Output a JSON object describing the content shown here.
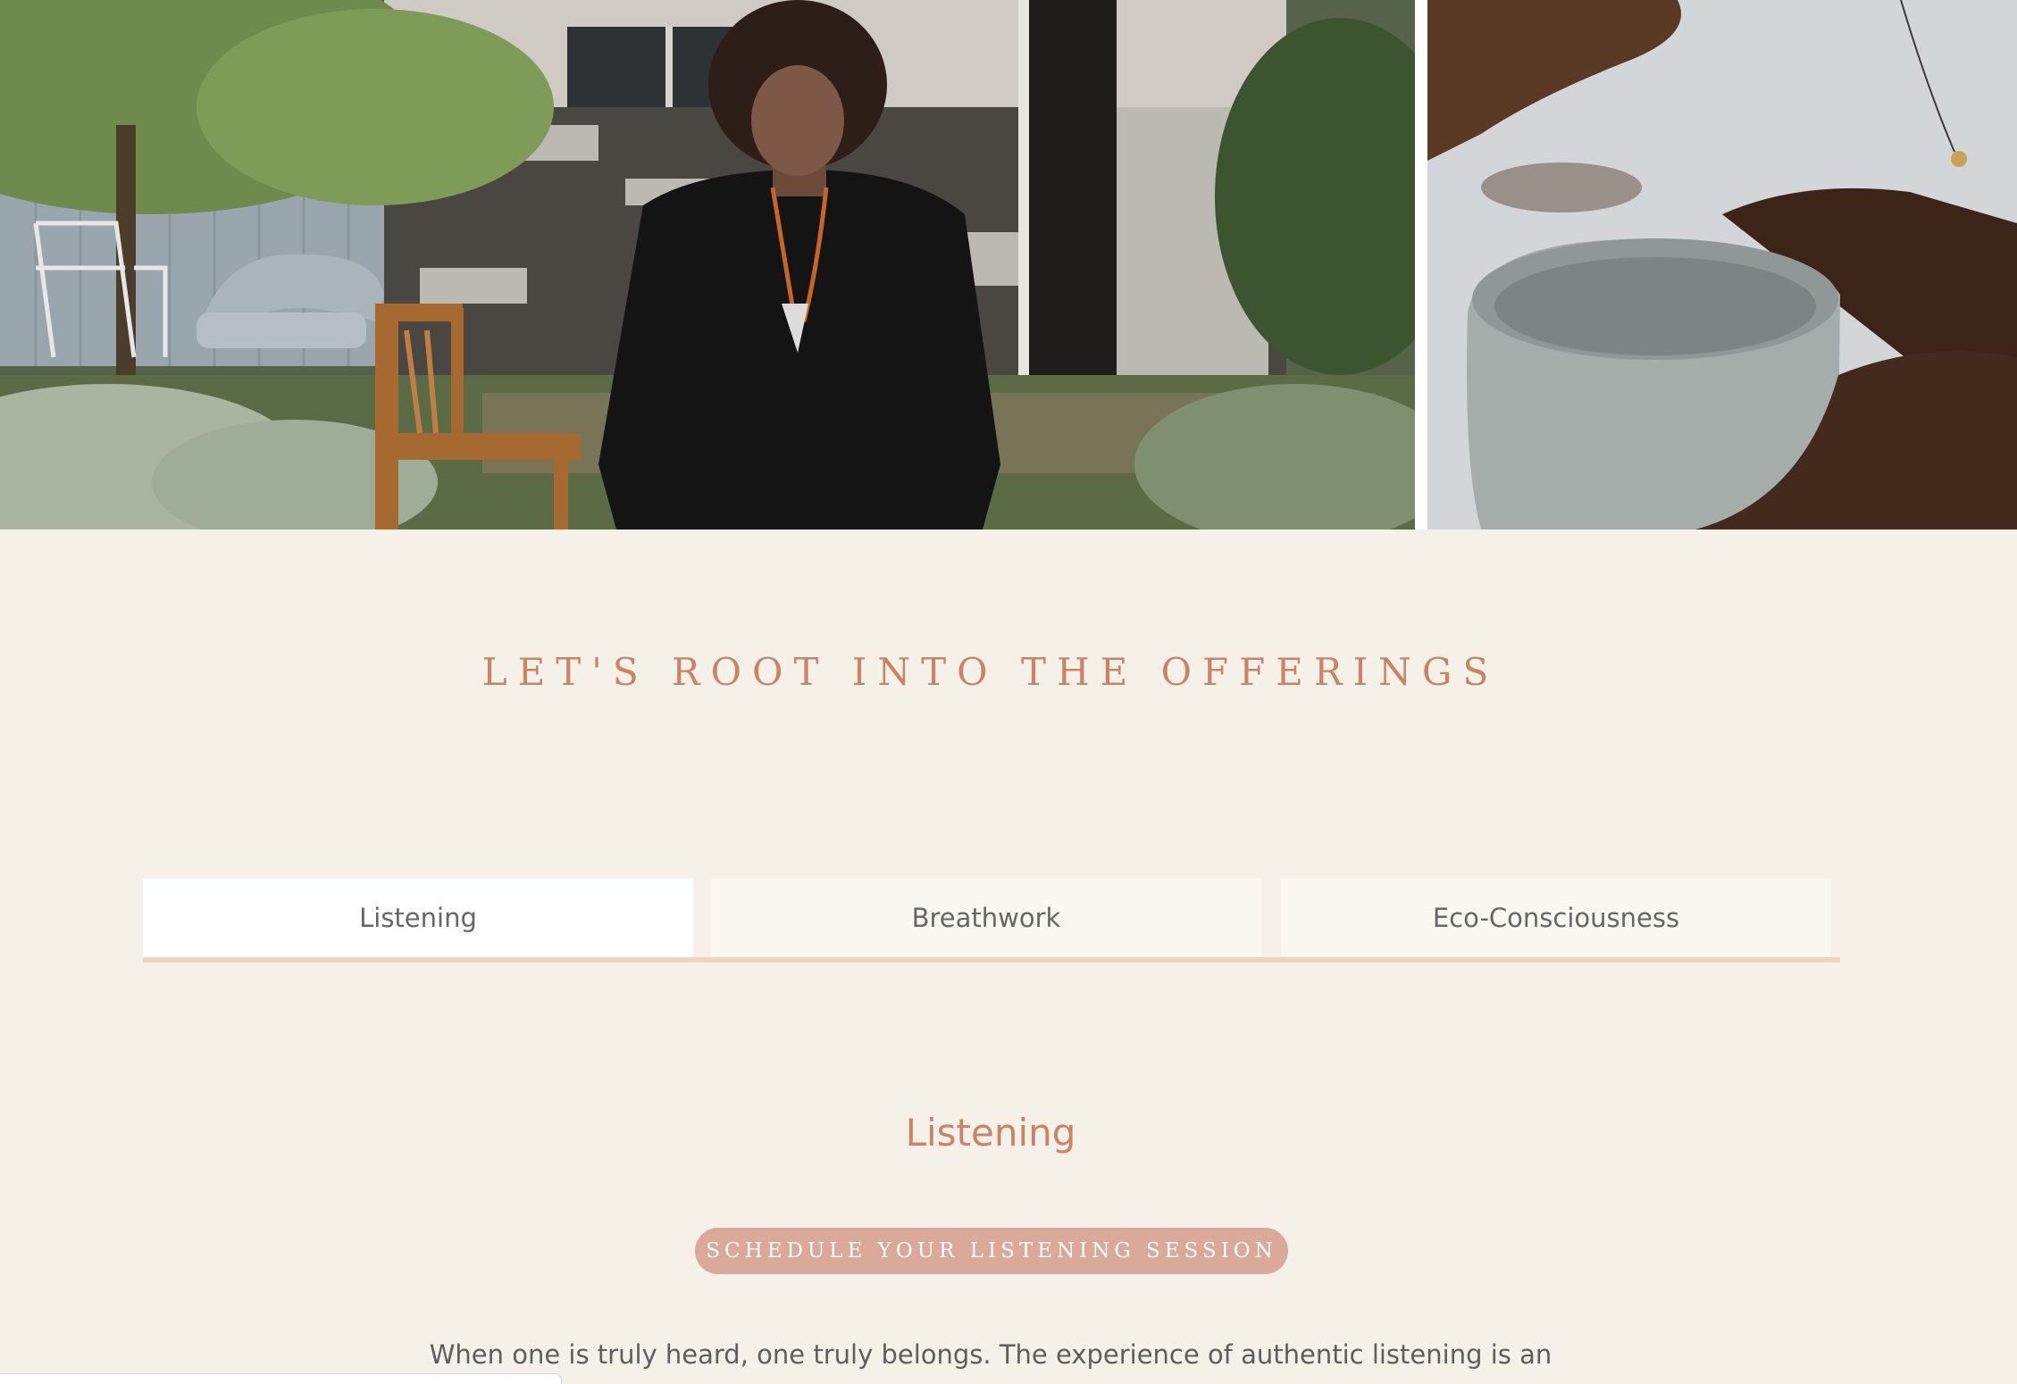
{
  "colors": {
    "page_background": "#f5f0e8",
    "accent_terracotta": "#c98466",
    "button_fill": "#dba99a",
    "tab_underline": "#f0d2c2",
    "tab_active_bg": "#ffffff",
    "tab_inactive_bg": "#faf7f1"
  },
  "hero": {
    "left_image": "portrait-woman-in-garden-photo",
    "right_image": "hands-holding-ceramic-cup-photo"
  },
  "section": {
    "title": "LET'S ROOT INTO THE OFFERINGS"
  },
  "tabs": [
    {
      "label": "Listening",
      "active": true
    },
    {
      "label": "Breathwork",
      "active": false
    },
    {
      "label": "Eco-Consciousness",
      "active": false
    }
  ],
  "panel": {
    "heading": "Listening",
    "cta_label": "SCHEDULE YOUR LISTENING SESSION",
    "body_first_line": "When one is truly heard, one truly belongs.  The experience of authentic listening is an"
  }
}
